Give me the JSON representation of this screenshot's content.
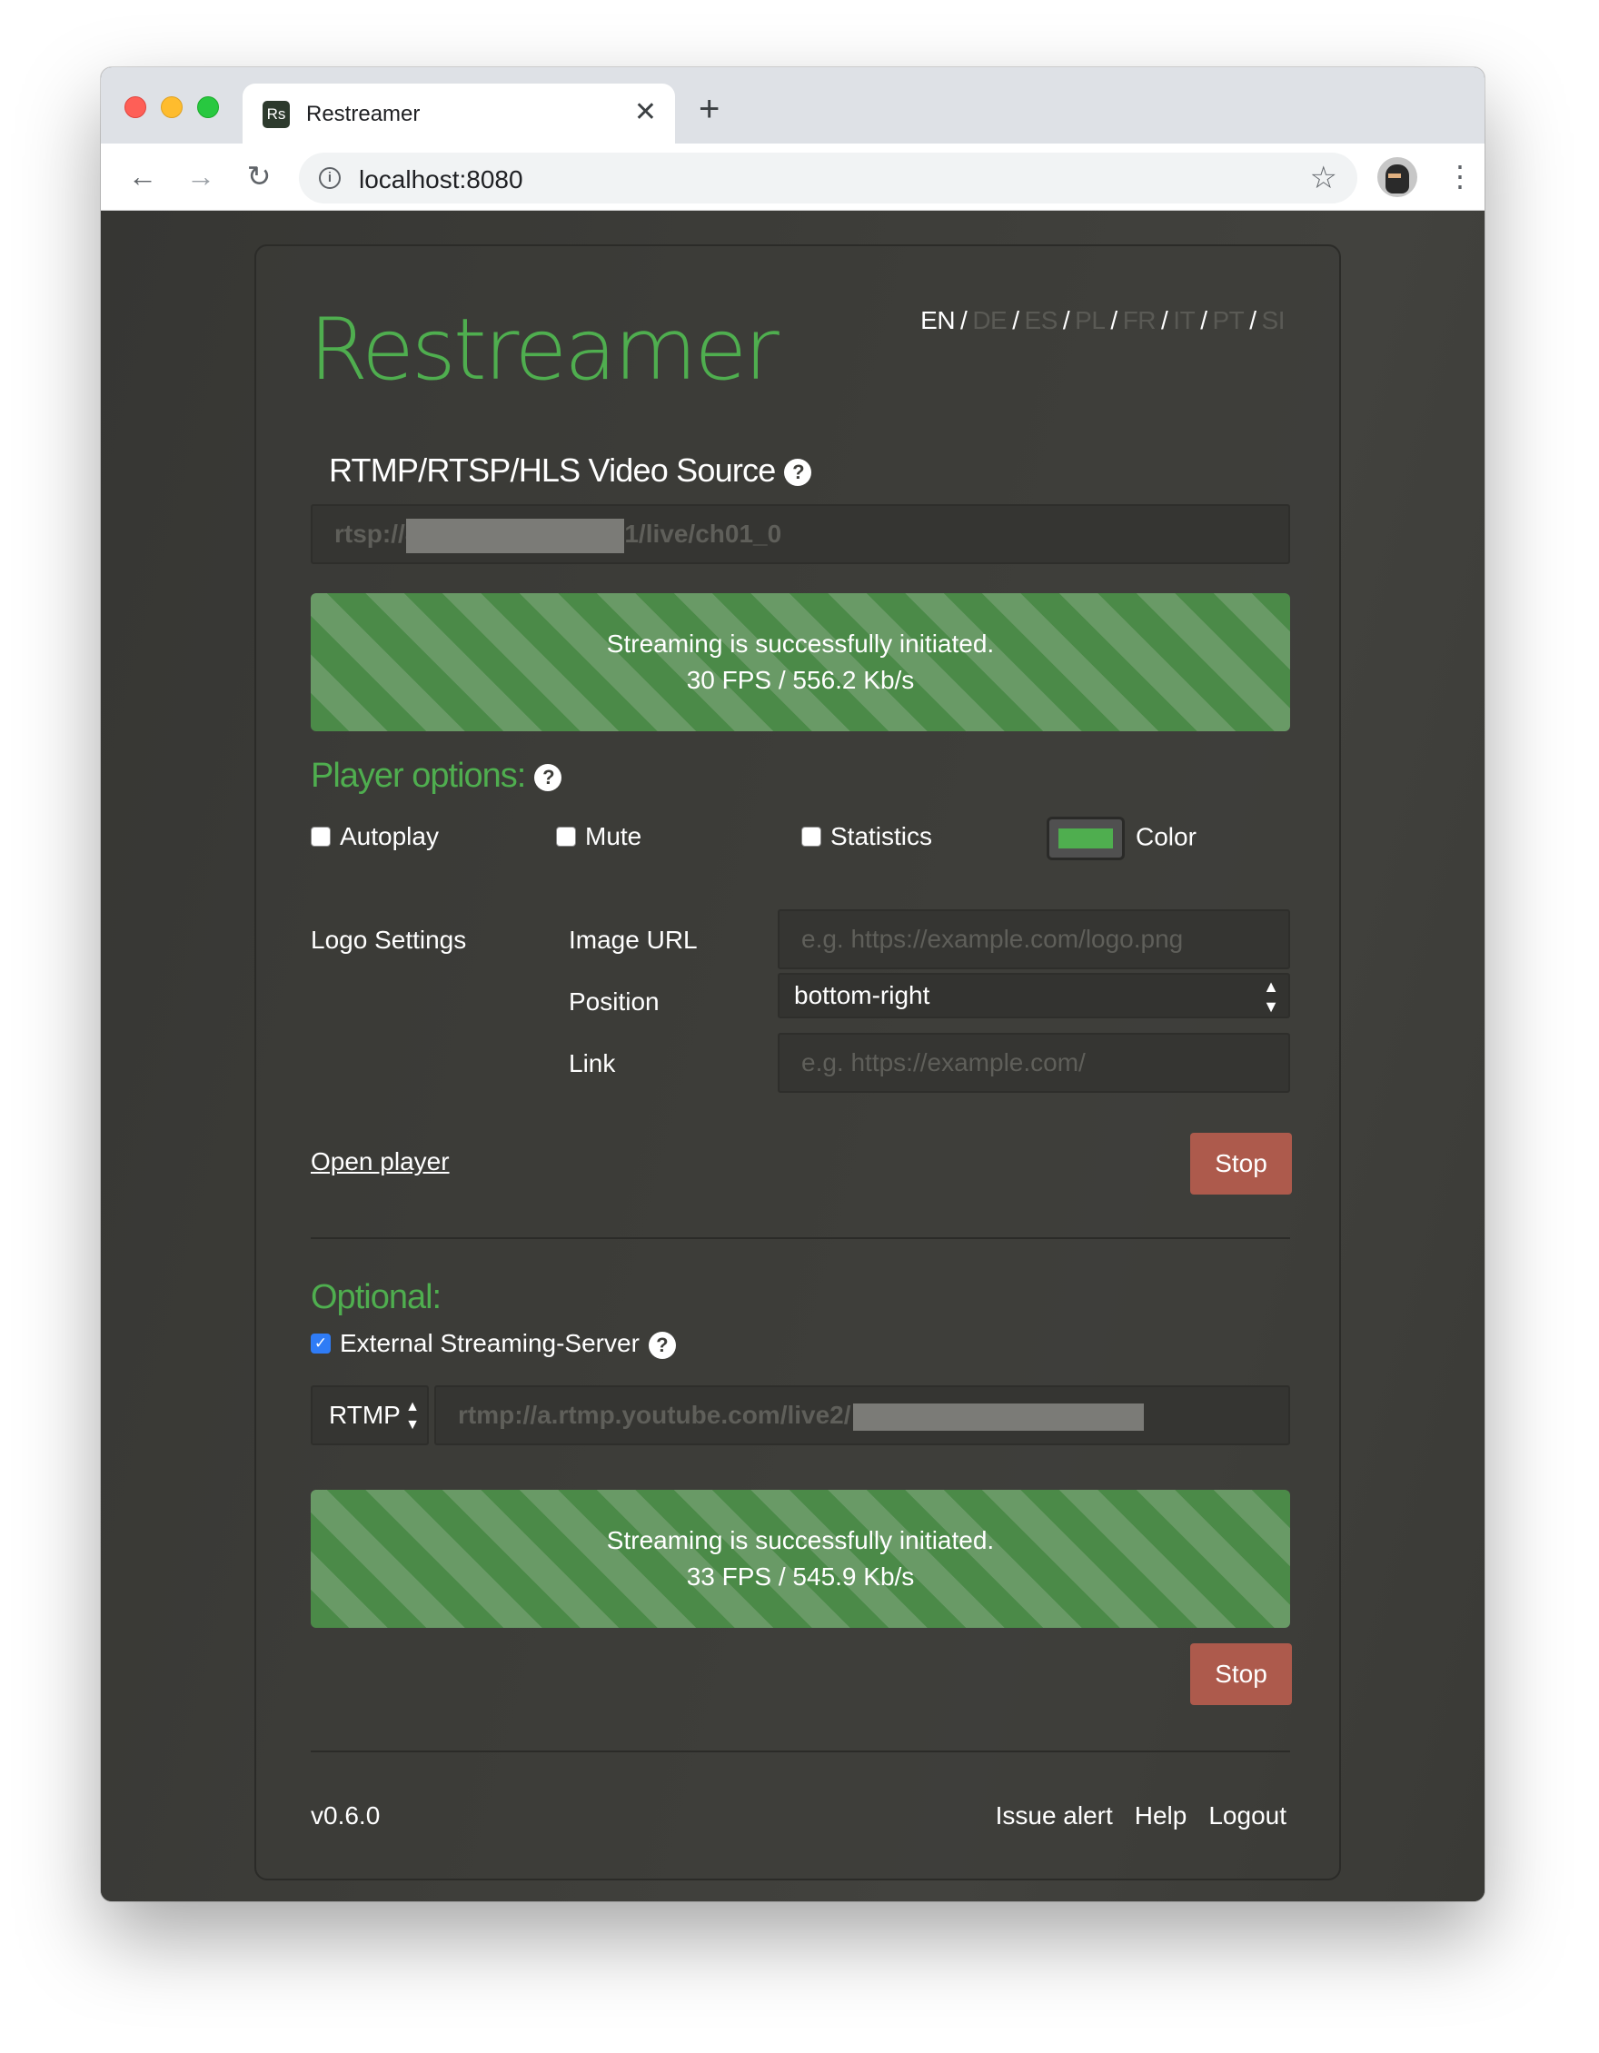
{
  "browser": {
    "tab_favicon": "Rs",
    "tab_title": "Restreamer",
    "url": "localhost:8080",
    "icons": {
      "back": "back-arrow-icon",
      "forward": "forward-arrow-icon",
      "reload": "reload-icon",
      "info": "info-icon",
      "star": "star-icon",
      "menu": "kebab-menu-icon",
      "close": "close-icon",
      "new_tab": "plus-icon"
    }
  },
  "app": {
    "logo": "Restreamer",
    "languages": [
      "EN",
      "DE",
      "ES",
      "PL",
      "FR",
      "IT",
      "PT",
      "SI"
    ],
    "active_language": "EN"
  },
  "source": {
    "heading": "RTMP/RTSP/HLS Video Source",
    "value_prefix": "rtsp://",
    "value_redacted_start": "8",
    "value_suffix": "1/live/ch01_0",
    "status_line1": "Streaming is successfully initiated.",
    "status_line2": "30 FPS / 556.2 Kb/s",
    "stop_label": "Stop"
  },
  "player_options": {
    "heading": "Player options:",
    "autoplay": {
      "label": "Autoplay",
      "checked": false
    },
    "mute": {
      "label": "Mute",
      "checked": false
    },
    "statistics": {
      "label": "Statistics",
      "checked": false
    },
    "color": {
      "label": "Color",
      "value": "#4fae4f"
    },
    "logo_settings_label": "Logo Settings",
    "image_url_label": "Image URL",
    "image_url_placeholder": "e.g. https://example.com/logo.png",
    "position_label": "Position",
    "position_value": "bottom-right",
    "link_label": "Link",
    "link_placeholder": "e.g. https://example.com/",
    "open_player": "Open player"
  },
  "optional": {
    "heading": "Optional:",
    "external_server_label": "External Streaming-Server",
    "external_server_checked": true,
    "protocol": "RTMP",
    "rtmp_url": "rtmp://a.rtmp.youtube.com/live2/",
    "status_line1": "Streaming is successfully initiated.",
    "status_line2": "33 FPS / 545.9 Kb/s",
    "stop_label": "Stop"
  },
  "footer": {
    "version": "v0.6.0",
    "links": [
      "Issue alert",
      "Help",
      "Logout"
    ]
  },
  "colors": {
    "accent_green": "#4fae4f",
    "stop_button": "#ad5a4c",
    "checkbox_checked": "#2f7cf6"
  }
}
